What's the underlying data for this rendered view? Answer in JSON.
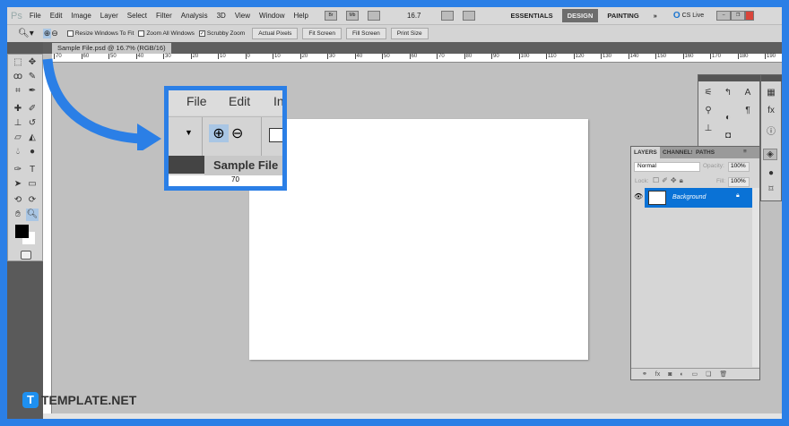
{
  "menu": {
    "logo": "Ps",
    "items": [
      "File",
      "Edit",
      "Image",
      "Layer",
      "Select",
      "Filter",
      "Analysis",
      "3D",
      "View",
      "Window",
      "Help"
    ],
    "bridge": "Br",
    "minibridge": "Mb",
    "zoom": "16.7",
    "workspaces": [
      "ESSENTIALS",
      "DESIGN",
      "PAINTING"
    ],
    "more": "»",
    "cslive": "CS Live"
  },
  "options": {
    "resize": "Resize Windows To Fit",
    "zoom_all": "Zoom All Windows",
    "scrubby": "Scrubby Zoom",
    "buttons": [
      "Actual Pixels",
      "Fit Screen",
      "Fill Screen",
      "Print Size"
    ]
  },
  "document": {
    "tab": "Sample File.psd @ 16.7% (RGB/16)"
  },
  "ruler": [
    "70",
    "60",
    "50",
    "40",
    "30",
    "20",
    "10",
    "0",
    "10",
    "20",
    "30",
    "40",
    "50",
    "60",
    "70",
    "80",
    "90",
    "100",
    "110",
    "120",
    "130",
    "140",
    "150",
    "160",
    "170",
    "180",
    "190"
  ],
  "callout": {
    "menu1": "File",
    "menu2": "Edit",
    "menu3": "In",
    "tab": "Sample File",
    "ruler": "70"
  },
  "layers": {
    "tabs": [
      "LAYERS",
      "CHANNELS",
      "PATHS"
    ],
    "blend": "Normal",
    "opacity_label": "Opacity:",
    "opacity": "100%",
    "lock_label": "Lock:",
    "fill_label": "Fill:",
    "fill": "100%",
    "layer_name": "Background"
  },
  "watermark": "TEMPLATE.NET"
}
